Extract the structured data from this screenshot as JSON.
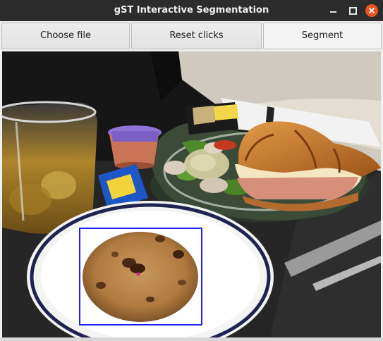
{
  "window": {
    "title": "gST Interactive Segmentation"
  },
  "toolbar": {
    "choose_file_label": "Choose file",
    "reset_clicks_label": "Reset clicks",
    "segment_label": "Segment"
  },
  "window_controls": {
    "minimize_icon": "minimize-icon",
    "maximize_icon": "maximize-icon",
    "close_icon": "close-icon"
  },
  "image": {
    "subject": "photo",
    "bbox_color": "#1f22ee",
    "click_point_color": "#c0307a"
  }
}
